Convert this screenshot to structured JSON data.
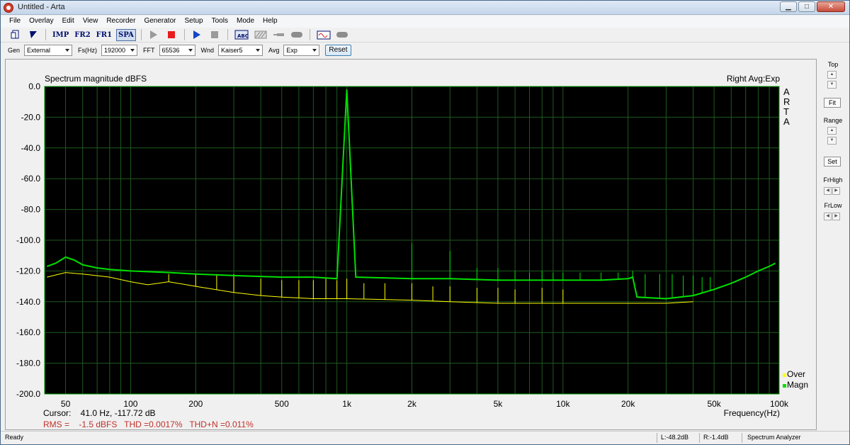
{
  "window": {
    "title": "Untitled - Arta"
  },
  "menu": [
    "File",
    "Overlay",
    "Edit",
    "View",
    "Recorder",
    "Generator",
    "Setup",
    "Tools",
    "Mode",
    "Help"
  ],
  "toolbar": {
    "imp": "IMP",
    "fr2": "FR2",
    "fr1": "FR1",
    "spa": "SPA"
  },
  "settings": {
    "gen_label": "Gen",
    "gen_value": "External",
    "fs_label": "Fs(Hz)",
    "fs_value": "192000",
    "fft_label": "FFT",
    "fft_value": "65536",
    "wnd_label": "Wnd",
    "wnd_value": "Kaiser5",
    "avg_label": "Avg",
    "avg_value": "Exp",
    "reset_label": "Reset"
  },
  "plot": {
    "title": "Spectrum magnitude dBFS",
    "channel_info": "Right Avg:Exp",
    "side_label": [
      "A",
      "R",
      "T",
      "A"
    ],
    "legend": [
      {
        "label": "Over",
        "color": "#ffff00"
      },
      {
        "label": "Magn",
        "color": "#00e000"
      }
    ],
    "cursor": "Cursor:    41.0 Hz, -117.72 dB",
    "measurements": "RMS =    -1.5 dBFS   THD =0.0017%   THD+N =0.011%",
    "background": "#000000",
    "grid_color": "#1f5a1f",
    "border_color": "#00a000",
    "measure_color": "#c0302a"
  },
  "chart_data": {
    "type": "line",
    "title": "Spectrum magnitude dBFS",
    "xlabel": "Frequency(Hz)",
    "ylabel": "",
    "xscale": "log",
    "xlim": [
      40,
      100000
    ],
    "ylim": [
      -200,
      0
    ],
    "grid": true,
    "legend_position": "bottom-right",
    "x_ticks": [
      "50",
      "100",
      "200",
      "500",
      "1k",
      "2k",
      "5k",
      "10k",
      "20k",
      "50k",
      "100k"
    ],
    "x_tick_values": [
      50,
      100,
      200,
      500,
      1000,
      2000,
      5000,
      10000,
      20000,
      50000,
      100000
    ],
    "y_ticks": [
      "0.0",
      "-20.0",
      "-40.0",
      "-60.0",
      "-80.0",
      "-100.0",
      "-120.0",
      "-140.0",
      "-160.0",
      "-180.0",
      "-200.0"
    ],
    "y_tick_values": [
      0,
      -20,
      -40,
      -60,
      -80,
      -100,
      -120,
      -140,
      -160,
      -180,
      -200
    ],
    "series": [
      {
        "name": "Magn",
        "color": "#00e000",
        "points": [
          [
            41,
            -117
          ],
          [
            45,
            -115
          ],
          [
            50,
            -111
          ],
          [
            55,
            -113
          ],
          [
            60,
            -116
          ],
          [
            70,
            -118
          ],
          [
            80,
            -119
          ],
          [
            100,
            -120
          ],
          [
            150,
            -121
          ],
          [
            200,
            -122
          ],
          [
            300,
            -123
          ],
          [
            500,
            -124
          ],
          [
            700,
            -124
          ],
          [
            900,
            -125
          ],
          [
            1000,
            -2
          ],
          [
            1100,
            -124
          ],
          [
            2000,
            -125
          ],
          [
            3000,
            -125
          ],
          [
            5000,
            -126
          ],
          [
            10000,
            -126
          ],
          [
            15000,
            -126
          ],
          [
            20000,
            -125
          ],
          [
            21000,
            -124
          ],
          [
            22000,
            -137
          ],
          [
            30000,
            -138
          ],
          [
            40000,
            -136
          ],
          [
            50000,
            -132
          ],
          [
            60000,
            -128
          ],
          [
            70000,
            -124
          ],
          [
            80000,
            -120
          ],
          [
            90000,
            -117
          ],
          [
            96000,
            -115
          ]
        ],
        "spikes": [
          [
            2000,
            -102
          ],
          [
            3000,
            -107
          ],
          [
            4000,
            -118
          ],
          [
            5000,
            -118
          ],
          [
            6000,
            -120
          ],
          [
            7000,
            -121
          ],
          [
            8000,
            -120
          ],
          [
            9000,
            -121
          ],
          [
            10000,
            -121
          ],
          [
            12000,
            -121
          ],
          [
            15000,
            -121
          ],
          [
            18000,
            -121
          ],
          [
            21000,
            -120
          ],
          [
            24000,
            -122
          ],
          [
            28000,
            -122
          ],
          [
            32000,
            -122
          ],
          [
            36000,
            -123
          ],
          [
            40000,
            -123
          ],
          [
            44000,
            -124
          ],
          [
            48000,
            -124
          ]
        ]
      },
      {
        "name": "Over",
        "color": "#ffff00",
        "points": [
          [
            41,
            -124
          ],
          [
            50,
            -121
          ],
          [
            60,
            -122
          ],
          [
            80,
            -124
          ],
          [
            100,
            -127
          ],
          [
            120,
            -129
          ],
          [
            150,
            -127
          ],
          [
            200,
            -130
          ],
          [
            300,
            -134
          ],
          [
            400,
            -136
          ],
          [
            500,
            -137
          ],
          [
            700,
            -138
          ],
          [
            1000,
            -138
          ],
          [
            2000,
            -139
          ],
          [
            3000,
            -140
          ],
          [
            5000,
            -141
          ],
          [
            10000,
            -141
          ],
          [
            20000,
            -141
          ],
          [
            30000,
            -141
          ],
          [
            40000,
            -140
          ]
        ],
        "spikes": [
          [
            150,
            -122
          ],
          [
            200,
            -122
          ],
          [
            250,
            -122
          ],
          [
            300,
            -122
          ],
          [
            400,
            -125
          ],
          [
            500,
            -126
          ],
          [
            600,
            -126
          ],
          [
            700,
            -126
          ],
          [
            800,
            -125
          ],
          [
            900,
            -126
          ],
          [
            1000,
            -125
          ],
          [
            1200,
            -128
          ],
          [
            1500,
            -128
          ],
          [
            2000,
            -128
          ],
          [
            2500,
            -130
          ],
          [
            3000,
            -130
          ],
          [
            4000,
            -131
          ],
          [
            5000,
            -131
          ],
          [
            6000,
            -132
          ],
          [
            8000,
            -131
          ],
          [
            10000,
            -132
          ]
        ]
      }
    ]
  },
  "right_panel": {
    "top": "Top",
    "fit": "Fit",
    "range": "Range",
    "set": "Set",
    "frhigh": "FrHigh",
    "frlow": "FrLow"
  },
  "status": {
    "ready": "Ready",
    "left_level": "L:-48.2dB",
    "right_level": "R:-1.4dB",
    "mode": "Spectrum Analyzer"
  }
}
